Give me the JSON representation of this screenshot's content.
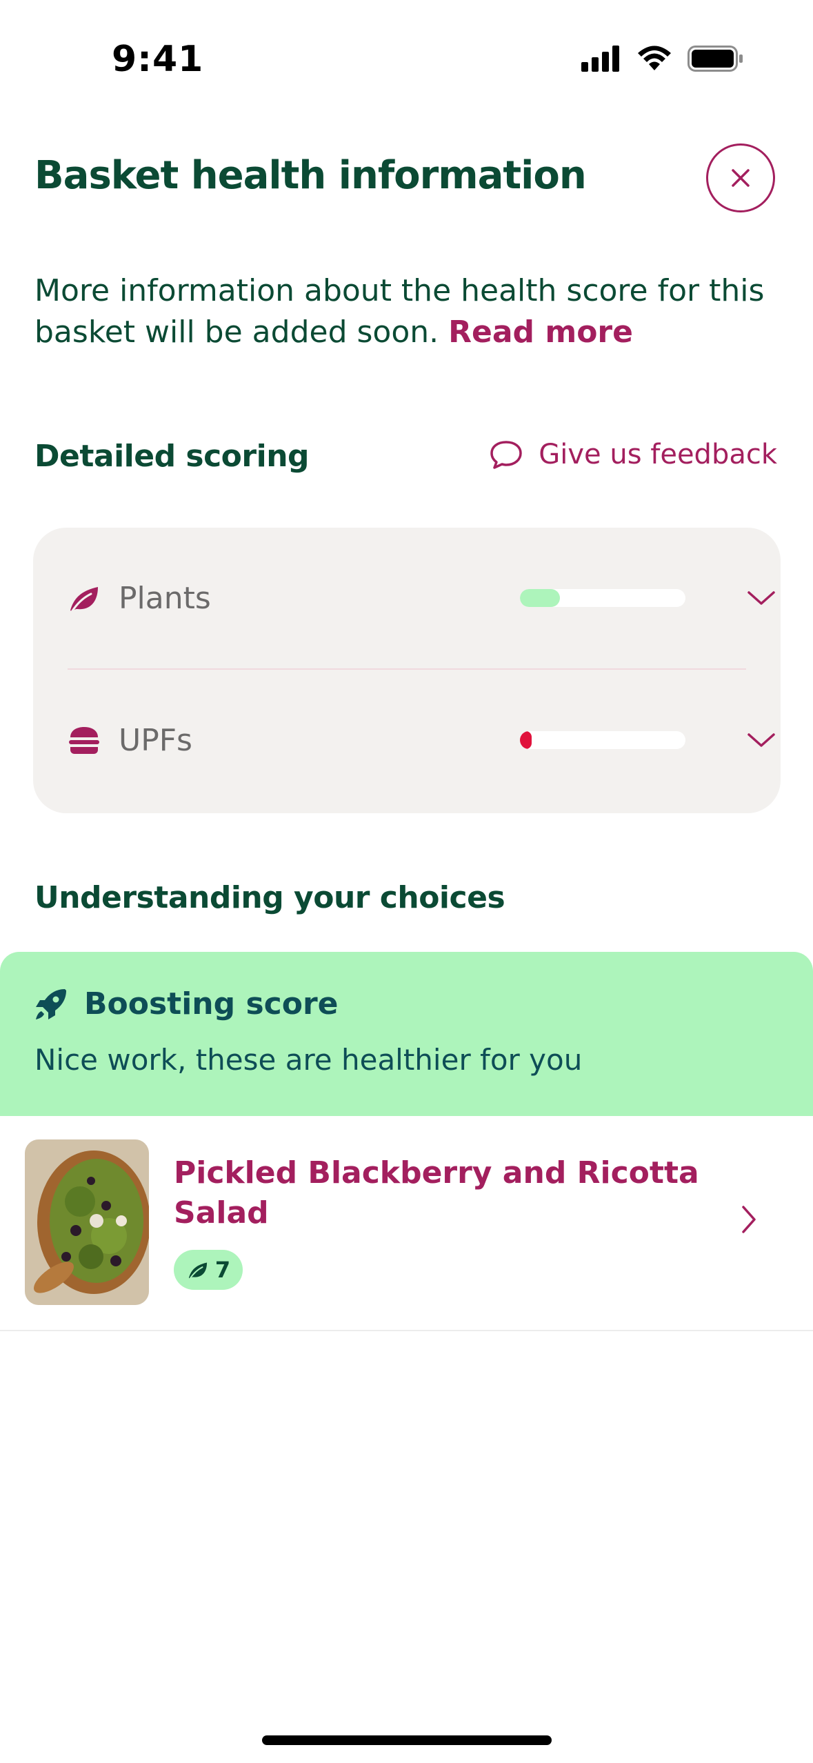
{
  "status_bar": {
    "time": "9:41"
  },
  "header": {
    "title": "Basket health information",
    "close_icon": "close-icon"
  },
  "intro": {
    "text": "More information about the health score for this basket will be added soon.",
    "link": "Read more"
  },
  "detailed_scoring": {
    "heading": "Detailed scoring",
    "feedback_label": "Give us feedback",
    "rows": [
      {
        "label": "Plants",
        "icon": "leaf-icon",
        "level": 0.24,
        "bar_color": "#adf4bb"
      },
      {
        "label": "UPFs",
        "icon": "burger-icon",
        "level": 0.07,
        "bar_color": "#e0123c"
      }
    ]
  },
  "choices": {
    "heading": "Understanding your choices",
    "banner": {
      "title": "Boosting score",
      "subtitle": "Nice work, these are healthier for you",
      "icon": "rocket-icon"
    },
    "items": [
      {
        "title": "Pickled Blackberry and Ricotta Salad",
        "badge_value": "7",
        "badge_icon": "leaf-icon"
      }
    ]
  },
  "colors": {
    "primary_green": "#0b4a34",
    "accent_magenta": "#a31f5e",
    "mint": "#adf4bb",
    "card_grey": "#f3f1ef"
  }
}
